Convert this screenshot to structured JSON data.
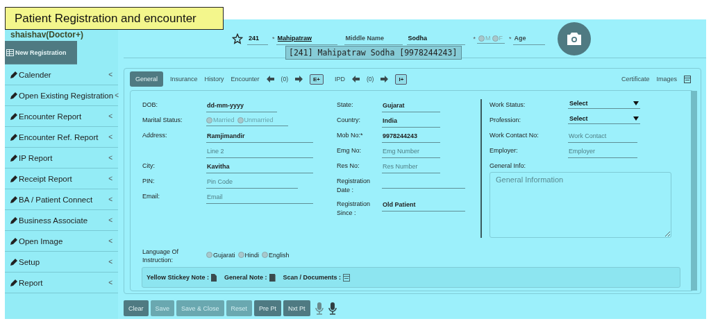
{
  "callout": {
    "text": "Patient Registration and encounter"
  },
  "sidebar": {
    "user": "shaishav(Doctor+)",
    "items": [
      {
        "label": "New Registration",
        "kind": "primary",
        "selected": true
      },
      {
        "label": "Calender",
        "kind": "menu",
        "selected": false,
        "chevron": "<"
      },
      {
        "label": "Open Existing Registration",
        "kind": "menu",
        "selected": false,
        "chevron": "<"
      },
      {
        "label": "Encounter Report",
        "kind": "menu",
        "selected": false,
        "chevron": "<"
      },
      {
        "label": "Encounter Ref. Report",
        "kind": "menu",
        "selected": false,
        "chevron": "<"
      },
      {
        "label": "IP Report",
        "kind": "menu",
        "selected": false,
        "chevron": "<"
      },
      {
        "label": "Receipt Report",
        "kind": "menu",
        "selected": false,
        "chevron": "<"
      },
      {
        "label": "BA / Patient Connect",
        "kind": "menu",
        "selected": false,
        "chevron": "<"
      },
      {
        "label": "Business Associate",
        "kind": "menu",
        "selected": false,
        "chevron": "<"
      },
      {
        "label": "Open Image",
        "kind": "menu",
        "selected": false,
        "chevron": "<"
      },
      {
        "label": "Setup",
        "kind": "menu",
        "selected": false,
        "chevron": "<"
      },
      {
        "label": "Report",
        "kind": "menu",
        "selected": false,
        "chevron": "<"
      }
    ]
  },
  "patient_header": {
    "id": "241",
    "first_name": {
      "required_mark": "*",
      "value": "Mahipatraw"
    },
    "middle_name": {
      "placeholder": "Middle Name"
    },
    "last_name": {
      "value": "Sodha"
    },
    "gender": {
      "required_mark": "*",
      "options": [
        {
          "label": "M",
          "selected": false
        },
        {
          "label": "F",
          "selected": false
        }
      ]
    },
    "age": {
      "required_mark": "*",
      "placeholder": "Age"
    },
    "suggestion": "[241] Mahipatraw Sodha [9978244243]"
  },
  "tabs": [
    {
      "label": "General",
      "selected": true
    },
    {
      "label": "Insurance",
      "selected": false
    },
    {
      "label": "History",
      "selected": false
    },
    {
      "label": "Encounter",
      "selected": false
    }
  ],
  "encounter_nav": {
    "count": "(0)",
    "add": "E+"
  },
  "ipd_nav": {
    "label": "IPD",
    "count": "(0)",
    "add": "I+"
  },
  "links": [
    "Certificate",
    "Images"
  ],
  "form": {
    "left": [
      {
        "label": "DOB:",
        "kind": "text",
        "value": "dd-mm-yyyy"
      },
      {
        "label": "Marital Status:",
        "kind": "radio",
        "options": [
          {
            "label": "Married",
            "selected": false,
            "disabled": true
          },
          {
            "label": "Unmarried",
            "selected": false,
            "disabled": true
          }
        ]
      },
      {
        "label": "Address:",
        "kind": "text",
        "value": "Ramjimandir"
      },
      {
        "kind": "text",
        "placeholder": "Line 2"
      },
      {
        "label": "City:",
        "kind": "text",
        "value": "Kavitha"
      },
      {
        "label": "PIN:",
        "kind": "text",
        "placeholder": "Pin Code"
      },
      {
        "label": "Email:",
        "kind": "text",
        "placeholder": "Email"
      }
    ],
    "middle": [
      {
        "label": "State:",
        "kind": "text",
        "value": "Gujarat"
      },
      {
        "label": "Country:",
        "kind": "text",
        "value": "India"
      },
      {
        "label": "Mob No:*",
        "kind": "text",
        "value": "9978244243"
      },
      {
        "label": "Emg No:",
        "kind": "text",
        "placeholder": "Emg Number"
      },
      {
        "label": "Res No:",
        "kind": "text",
        "placeholder": "Res Number"
      },
      {
        "label": "Registration Date :",
        "kind": "text"
      },
      {
        "label": "Registration Since :",
        "kind": "text",
        "value": "Old Patient"
      }
    ],
    "right": [
      {
        "label": "Work Status:",
        "kind": "select",
        "value": "Select"
      },
      {
        "label": "Profession:",
        "kind": "select",
        "value": "Select"
      },
      {
        "label": "Work Contact No:",
        "kind": "text",
        "placeholder": "Work Contact"
      },
      {
        "label": "Employer:",
        "kind": "text",
        "placeholder": "Employer"
      },
      {
        "label": "General Info:",
        "kind": "textarea",
        "placeholder": "General Information"
      }
    ],
    "language": {
      "label": "Language Of Instruction:",
      "options": [
        {
          "label": "Gujarati",
          "selected": false,
          "disabled": false
        },
        {
          "label": "Hindi",
          "selected": false,
          "disabled": false
        },
        {
          "label": "English",
          "selected": false,
          "disabled": false
        }
      ]
    }
  },
  "notes": [
    {
      "label": "Yellow Stickey Note :",
      "kind": "sticky"
    },
    {
      "label": "General Note :",
      "kind": "book"
    },
    {
      "label": "Scan / Documents :",
      "kind": "scan"
    }
  ],
  "buttons": [
    {
      "label": "Clear",
      "disabled": false
    },
    {
      "label": "Save",
      "disabled": true
    },
    {
      "label": "Save & Close",
      "disabled": true
    },
    {
      "label": "Reset",
      "disabled": true
    },
    {
      "label": "Pre Pt",
      "disabled": false
    },
    {
      "label": "Nxt Pt",
      "disabled": false
    }
  ]
}
